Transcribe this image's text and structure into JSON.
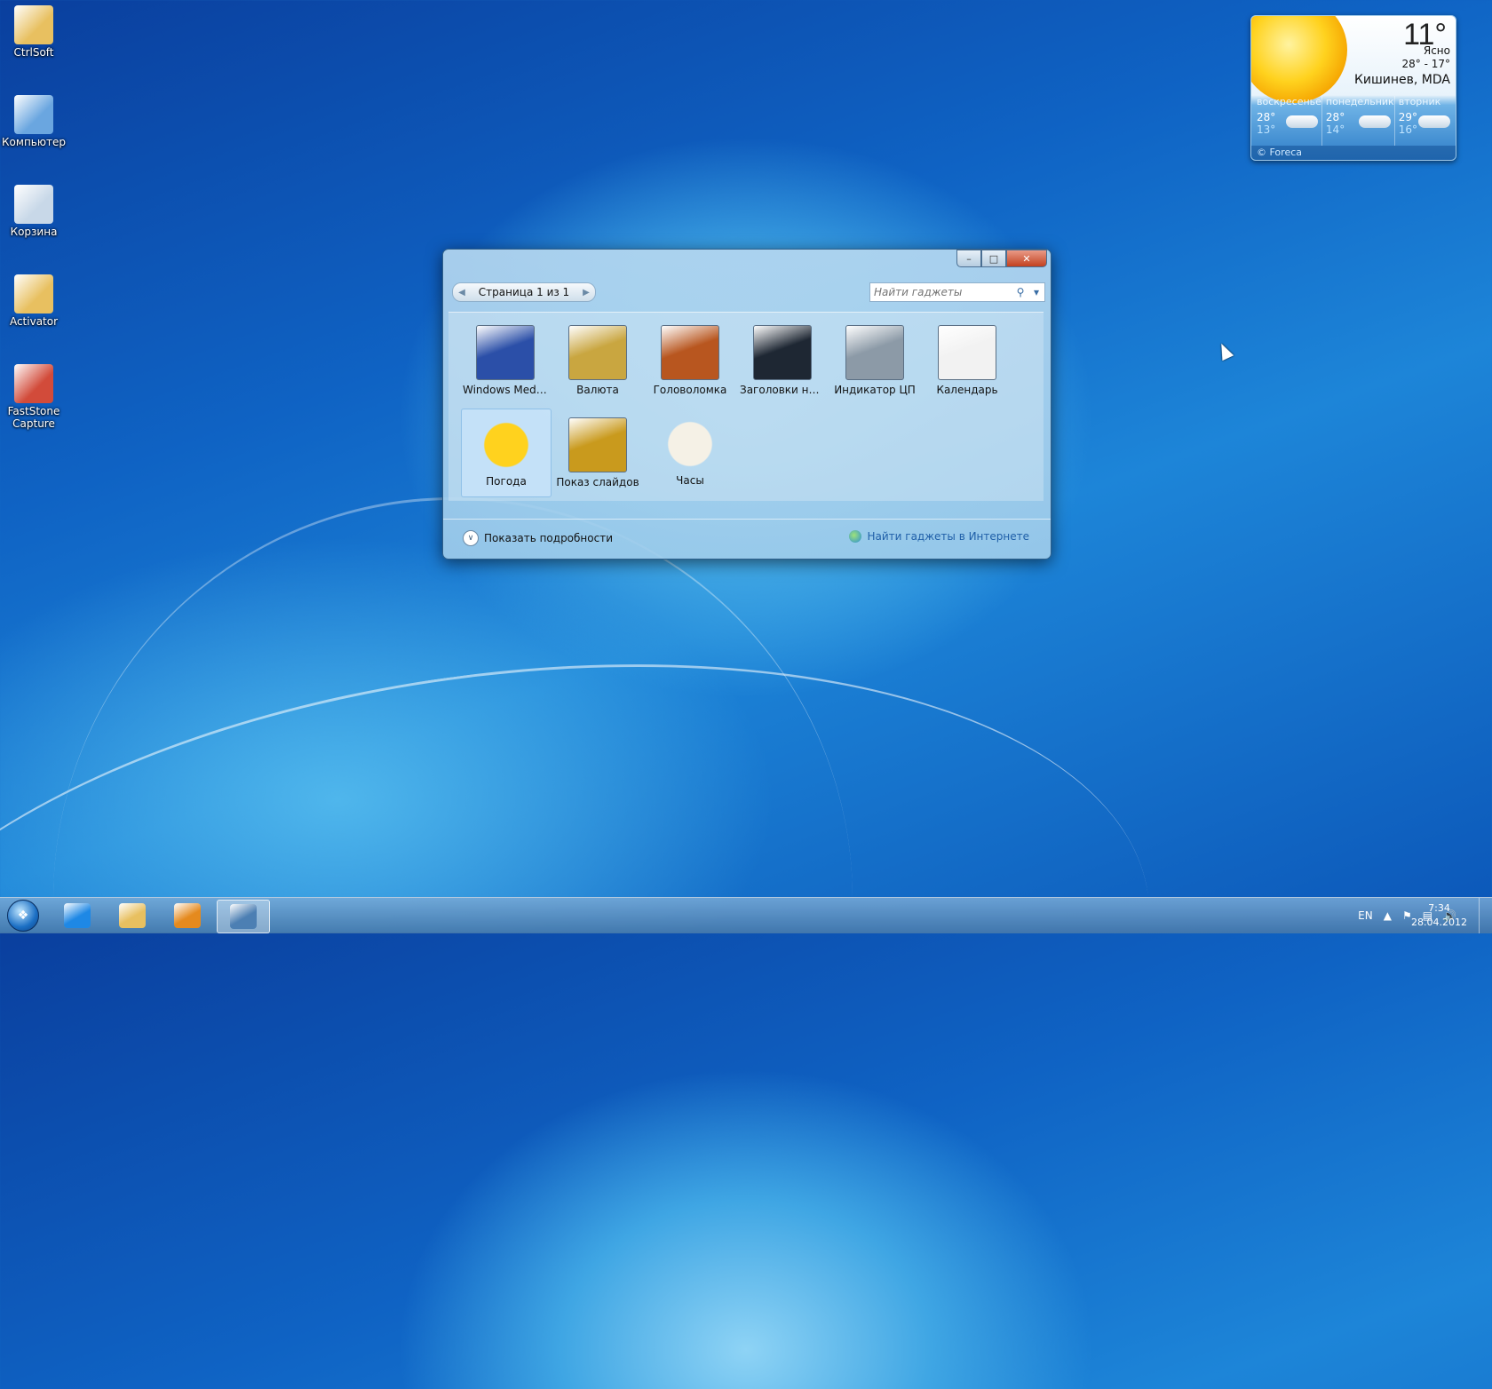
{
  "desktop_icons": [
    {
      "label": "CtrlSoft",
      "icon": "folder-user-icon"
    },
    {
      "label": "Компьютер",
      "icon": "computer-icon"
    },
    {
      "label": "Корзина",
      "icon": "recycle-bin-icon"
    },
    {
      "label": "Activator",
      "icon": "folder-icon"
    },
    {
      "label": "FastStone Capture",
      "icon": "faststone-capture-icon"
    }
  ],
  "weather": {
    "temp": "11°",
    "condition": "Ясно",
    "range": "28° - 17°",
    "city": "Кишинев, MDA",
    "forecast": [
      {
        "day": "воскресенье",
        "hi": "28°",
        "lo": "13°"
      },
      {
        "day": "понедельник",
        "hi": "28°",
        "lo": "14°"
      },
      {
        "day": "вторник",
        "hi": "29°",
        "lo": "16°"
      }
    ],
    "footer": "© Foreca"
  },
  "gallery": {
    "pager_label": "Страница 1 из 1",
    "search_placeholder": "Найти гаджеты",
    "gadgets": [
      {
        "label": "Windows Media...",
        "icon": "windows-media-center-icon",
        "color": "#2b4fa8",
        "selected": false
      },
      {
        "label": "Валюта",
        "icon": "currency-icon",
        "color": "#c9a640",
        "selected": false
      },
      {
        "label": "Головоломка",
        "icon": "puzzle-icon",
        "color": "#b8561f",
        "selected": false
      },
      {
        "label": "Заголовки нов...",
        "icon": "feed-headlines-icon",
        "color": "#1e2733",
        "selected": false
      },
      {
        "label": "Индикатор ЦП",
        "icon": "cpu-meter-icon",
        "color": "#8c9aa7",
        "selected": false
      },
      {
        "label": "Календарь",
        "icon": "calendar-icon",
        "color": "#f2f2f2",
        "selected": false
      },
      {
        "label": "Погода",
        "icon": "weather-sun-icon",
        "color": "#ffd21e",
        "selected": true
      },
      {
        "label": "Показ слайдов",
        "icon": "slideshow-icon",
        "color": "#c99a1d",
        "selected": false
      },
      {
        "label": "Часы",
        "icon": "clock-icon",
        "color": "#f5f1e6",
        "selected": false
      }
    ],
    "show_details_label": "Показать подробности",
    "online_link_label": "Найти гаджеты в Интернете"
  },
  "taskbar": {
    "items": [
      {
        "name": "internet-explorer-icon",
        "color": "#1e88e5"
      },
      {
        "name": "file-explorer-icon",
        "color": "#e8c060"
      },
      {
        "name": "media-player-icon",
        "color": "#e58a1e"
      },
      {
        "name": "gadgets-icon",
        "color": "#4c7fb3"
      }
    ],
    "language": "EN",
    "time": "7:34",
    "date": "28.04.2012"
  }
}
